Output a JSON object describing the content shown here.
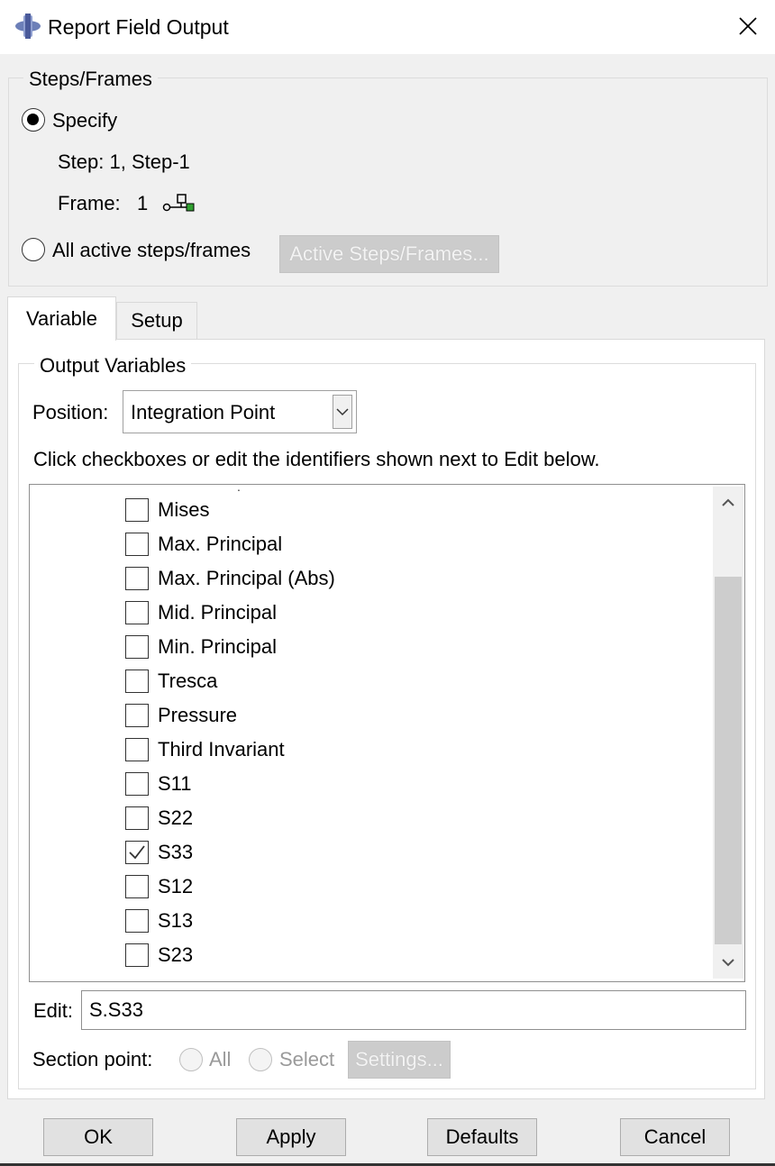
{
  "window": {
    "title": "Report Field Output",
    "close_icon": "close-icon",
    "app_icon": "abaqus-app-icon"
  },
  "steps_frames": {
    "group_label": "Steps/Frames",
    "specify_label": "Specify",
    "specify_selected": true,
    "step_text": "Step: 1, Step-1",
    "frame_label": "Frame:",
    "frame_value": "1",
    "frame_picker_icon": "frame-select-icon",
    "all_active_label": "All active steps/frames",
    "all_active_selected": false,
    "active_button_label": "Active Steps/Frames...",
    "active_button_enabled": false
  },
  "tabs": [
    {
      "label": "Variable",
      "active": true
    },
    {
      "label": "Setup",
      "active": false
    }
  ],
  "output_variables": {
    "group_label": "Output Variables",
    "position_label": "Position:",
    "position_value": "Integration Point",
    "instruction": "Click checkboxes or edit the identifiers shown next to Edit below.",
    "items": [
      {
        "label": "Mises",
        "checked": false
      },
      {
        "label": "Max. Principal",
        "checked": false
      },
      {
        "label": "Max. Principal (Abs)",
        "checked": false
      },
      {
        "label": "Mid. Principal",
        "checked": false
      },
      {
        "label": "Min. Principal",
        "checked": false
      },
      {
        "label": "Tresca",
        "checked": false
      },
      {
        "label": "Pressure",
        "checked": false
      },
      {
        "label": "Third Invariant",
        "checked": false
      },
      {
        "label": "S11",
        "checked": false
      },
      {
        "label": "S22",
        "checked": false
      },
      {
        "label": "S33",
        "checked": true
      },
      {
        "label": "S12",
        "checked": false
      },
      {
        "label": "S13",
        "checked": false
      },
      {
        "label": "S23",
        "checked": false
      }
    ],
    "edit_label": "Edit:",
    "edit_value": "S.S33",
    "section_point_label": "Section point:",
    "all_label": "All",
    "select_label": "Select",
    "settings_label": "Settings..."
  },
  "buttons": {
    "ok": "OK",
    "apply": "Apply",
    "defaults": "Defaults",
    "cancel": "Cancel"
  }
}
